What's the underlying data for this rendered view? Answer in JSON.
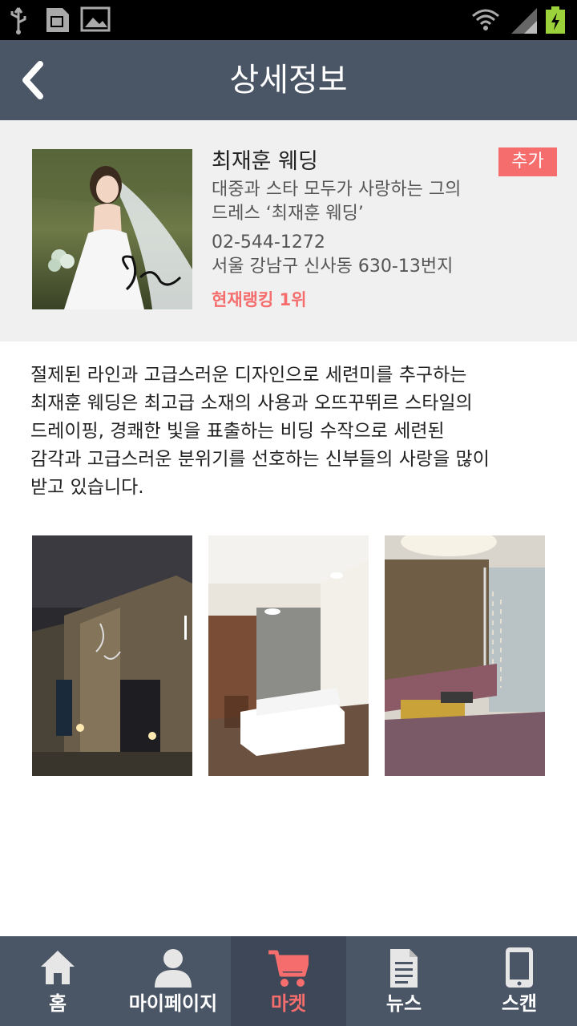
{
  "header": {
    "title": "상세정보"
  },
  "shop": {
    "name": "최재훈 웨딩",
    "add_label": "추가",
    "description_line1": "대중과 스타 모두가 사랑하는 그의",
    "description_line2": "드레스 ‘최재훈 웨딩’",
    "phone": "02-544-1272",
    "address": "서울 강남구 신사동 630-13번지",
    "ranking": "현재랭킹 1위"
  },
  "description": {
    "line1": "절제된 라인과 고급스러운 디자인으로 세련미를 추구하는",
    "line2": "최재훈 웨딩은 최고급 소재의 사용과 오뜨꾸뛰르 스타일의",
    "line3": "드레이핑, 경쾌한 빛을 표출하는 비딩 수작으로 세련된",
    "line4": "감각과 고급스러운 분위기를 선호하는 신부들의 사랑을 많이",
    "line5": "받고 있습니다."
  },
  "nav": {
    "items": [
      {
        "label": "홈",
        "icon": "home-icon"
      },
      {
        "label": "마이페이지",
        "icon": "person-icon"
      },
      {
        "label": "마켓",
        "icon": "cart-icon",
        "active": true
      },
      {
        "label": "뉴스",
        "icon": "document-icon"
      },
      {
        "label": "스캔",
        "icon": "tablet-icon"
      }
    ]
  },
  "colors": {
    "header_bg": "#4a5566",
    "accent": "#f56d6d",
    "info_bg": "#f0f0f0"
  }
}
